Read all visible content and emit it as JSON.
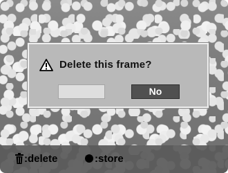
{
  "dialog": {
    "title": "Delete this frame?",
    "yes_label": "",
    "no_label": "No"
  },
  "bottom_bar": {
    "delete_label": ":delete",
    "store_label": ":store"
  },
  "icons": {
    "warning": "warning-icon",
    "trash": "trash-icon",
    "store": "record-dot-icon"
  }
}
